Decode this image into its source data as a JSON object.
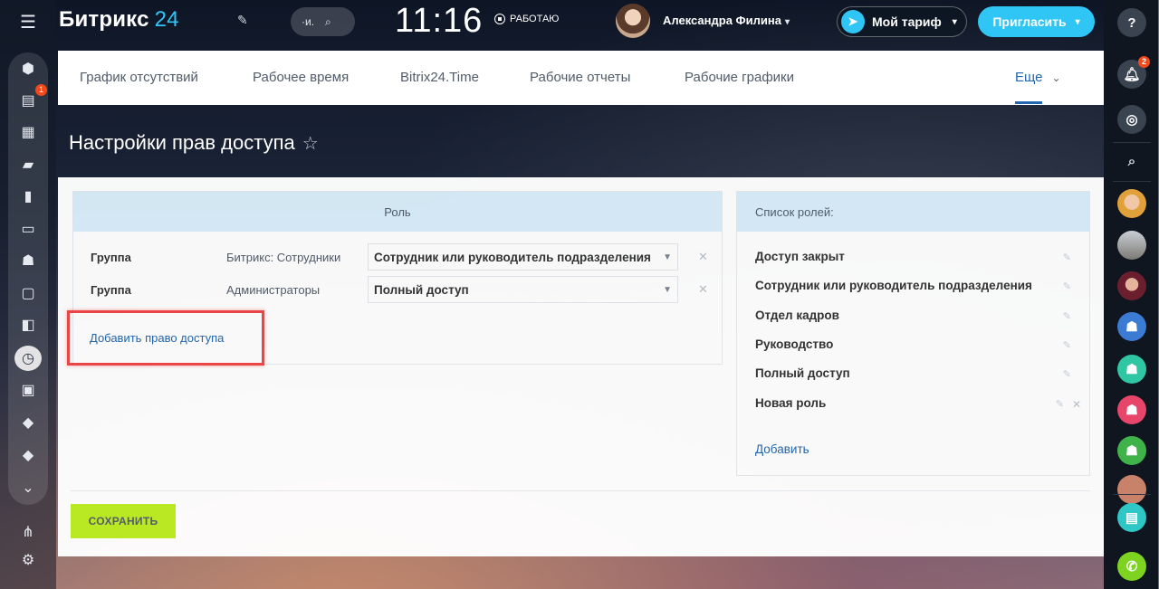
{
  "header": {
    "brand": "Битрикс",
    "brand_num": "24",
    "search_text": "·и.",
    "clock": "11:16",
    "work_status": "РАБОТАЮ",
    "user_name": "Александра Филина",
    "tariff_label": "Мой тариф",
    "invite_label": "Пригласить"
  },
  "left_bar": {
    "notification_badge": "1"
  },
  "right_bar": {
    "help_label": "?",
    "notification_badge": "2"
  },
  "nav": {
    "tabs": [
      "График отсутствий",
      "Рабочее время",
      "Bitrix24.Time",
      "Рабочие отчеты",
      "Рабочие графики"
    ],
    "more_label": "Еще"
  },
  "page": {
    "title": "Настройки прав доступа"
  },
  "access_table": {
    "header": "Роль",
    "rows": [
      {
        "type": "Группа",
        "subject": "Битрикс: Сотрудники",
        "role": "Сотрудник или руководитель подразделения"
      },
      {
        "type": "Группа",
        "subject": "Администраторы",
        "role": "Полный доступ"
      }
    ],
    "add_link": "Добавить право доступа"
  },
  "roles_panel": {
    "header": "Список ролей:",
    "roles": [
      "Доступ закрыт",
      "Сотрудник или руководитель подразделения",
      "Отдел кадров",
      "Руководство",
      "Полный доступ",
      "Новая роль"
    ],
    "add_link": "Добавить"
  },
  "actions": {
    "save_label": "СОХРАНИТЬ"
  },
  "colors": {
    "accent": "#2fc6f6",
    "link": "#2067b0",
    "save": "#bbed21",
    "highlight": "#f04545"
  }
}
